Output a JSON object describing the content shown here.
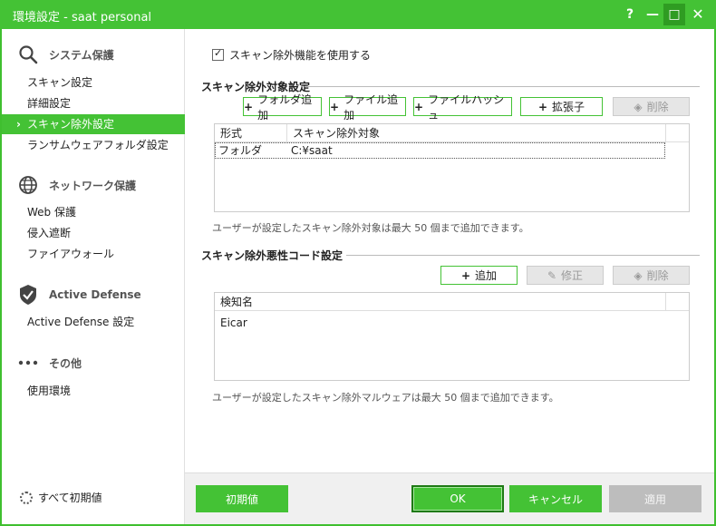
{
  "window": {
    "title": "環境設定 - saat personal",
    "help": "?",
    "minimize": "—",
    "maximize": "□",
    "close": "✕"
  },
  "sidebar": {
    "sections": [
      {
        "title": "システム保護",
        "icon": "search-icon",
        "items": [
          "スキャン設定",
          "詳細設定",
          "スキャン除外設定",
          "ランサムウェアフォルダ設定"
        ]
      },
      {
        "title": "ネットワーク保護",
        "icon": "globe-icon",
        "items": [
          "Web 保護",
          "侵入遮断",
          "ファイアウォール"
        ]
      },
      {
        "title": "Active Defense",
        "icon": "shield-icon",
        "items": [
          "Active Defense 設定"
        ]
      },
      {
        "title": "その他",
        "icon": "more-icon",
        "items": [
          "使用環境"
        ]
      }
    ],
    "active_item": "スキャン除外設定",
    "reset_all": "すべて初期値"
  },
  "main": {
    "use_exclusion_checkbox": {
      "label": "スキャン除外機能を使用する",
      "checked": true
    },
    "exclusion_targets": {
      "title": "スキャン除外対象設定",
      "buttons": {
        "add_folder": "フォルダ追加",
        "add_file": "ファイル追加",
        "file_hash": "ファイルハッシュ",
        "extension": "拡張子",
        "delete": "削除"
      },
      "columns": [
        "形式",
        "スキャン除外対象"
      ],
      "rows": [
        {
          "type": "フォルダ",
          "target": "C:¥saat"
        }
      ],
      "note": "ユーザーが設定したスキャン除外対象は最大 50 個まで追加できます。"
    },
    "exclusion_malware": {
      "title": "スキャン除外悪性コード設定",
      "buttons": {
        "add": "追加",
        "edit": "修正",
        "delete": "削除"
      },
      "columns": [
        "検知名"
      ],
      "rows": [
        {
          "name": "Eicar"
        }
      ],
      "note": "ユーザーが設定したスキャン除外マルウェアは最大 50 個まで追加できます。"
    }
  },
  "footer": {
    "default": "初期値",
    "ok": "OK",
    "cancel": "キャンセル",
    "apply": "適用"
  },
  "colors": {
    "accent": "#44c235",
    "disabled": "#bdbdbd"
  }
}
